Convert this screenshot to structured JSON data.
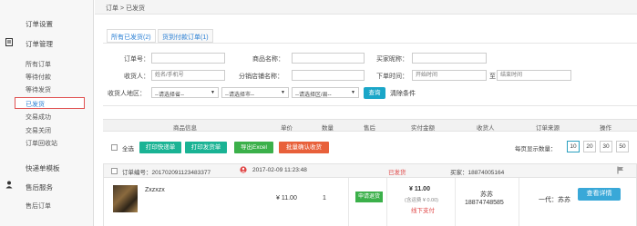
{
  "sidebar": {
    "items": [
      {
        "label": "订单设置",
        "type": "head"
      },
      {
        "label": "订单管理",
        "type": "head"
      },
      {
        "label": "所有订单",
        "type": "item"
      },
      {
        "label": "等待付款",
        "type": "item"
      },
      {
        "label": "等待发货",
        "type": "item"
      },
      {
        "label": "已发货",
        "type": "item",
        "active": true
      },
      {
        "label": "交易成功",
        "type": "item"
      },
      {
        "label": "交易关闭",
        "type": "item"
      },
      {
        "label": "订单回收站",
        "type": "item"
      },
      {
        "label": "快递单模板",
        "type": "head"
      },
      {
        "label": "售后服务",
        "type": "head"
      },
      {
        "label": "售后订单",
        "type": "item"
      }
    ]
  },
  "breadcrumb": "订单 > 已发货",
  "tabs": [
    {
      "label": "所有已发货(2)",
      "active": true
    },
    {
      "label": "货到付款订单(1)",
      "active": false
    }
  ],
  "filters": {
    "order_no_label": "订单号：",
    "product_name_label": "商品名称：",
    "buyer_nick_label": "买家昵称：",
    "receiver_label": "收货人：",
    "receiver_placeholder": "姓名/手机号",
    "dist_shop_label": "分销店铺名称：",
    "order_time_label": "下单时间：",
    "start_placeholder": "开始时间",
    "to_label": "至",
    "end_placeholder": "结束时间",
    "region_label": "收货人地区：",
    "province": "--请选择省--",
    "city": "--请选择市--",
    "district": "--请选择区/县--",
    "query_button": "查询",
    "clear_link": "清除条件"
  },
  "table_headers": [
    "商品信息",
    "单价",
    "数量",
    "售后",
    "实付金额",
    "收货人",
    "订单来源",
    "操作"
  ],
  "toolbar": {
    "select_all": "全选",
    "print_express": "打印快递单",
    "print_invoice": "打印发货单",
    "export_excel": "导出Excel",
    "batch_confirm": "批量确认收货",
    "per_page_label": "每页显示数量：",
    "per_page_options": [
      "10",
      "20",
      "30",
      "50"
    ],
    "per_page_selected": "10"
  },
  "order": {
    "order_no": "订单编号：2017020911234833​77",
    "order_time": "2017-02-09 11:23:48",
    "status": "已发货",
    "buyer": "买家：18874005164",
    "product_name": "Zxzxzx",
    "unit_price": "¥ 11.00",
    "quantity": "1",
    "after_sale_button": "申请退货",
    "paid_amount": "¥ 11.00",
    "shipping_fee": "(含运费 ¥ 0.00)",
    "payment_method": "线下支付",
    "receiver_name": "苏苏",
    "receiver_phone": "18874748585",
    "source": "一代：苏苏",
    "detail_button": "查看详情"
  },
  "colors": {
    "accent": "#1aa6c8",
    "status_red": "#e04545",
    "green": "#3bb04a",
    "orange": "#e8603a",
    "teal": "#1ab394"
  }
}
